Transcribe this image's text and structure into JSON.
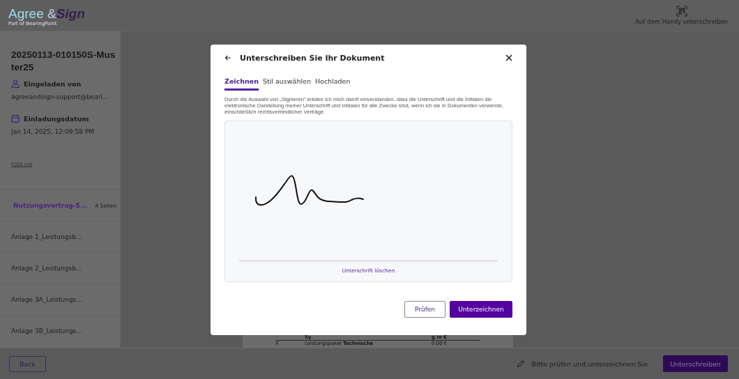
{
  "header": {
    "logo": {
      "word_1": "Agree",
      "ampersand": "&",
      "word_2": "Sign",
      "tagline": "Part of BearingPoint"
    },
    "mobile_sign": "Auf dem Handy unterschreiben"
  },
  "sidebar": {
    "document_title": "20250113-010150S-Muster25",
    "invited_by": {
      "label": "Eingeladen von",
      "value": "agreeandsign-support@beari..."
    },
    "invitation_date": {
      "label": "Einladungsdatum",
      "value": "Jan 14, 2025, 12:09:58 PM"
    },
    "foss_link": "FOSS List",
    "documents": [
      {
        "name": "Nutzungsvertrag-S...",
        "pages": "4 Seiten",
        "selected": true
      },
      {
        "name": "Anlage 1_Leistungsb...",
        "selected": false
      },
      {
        "name": "Anlage 2_Leistungsb...",
        "selected": false
      },
      {
        "name": "Anlage 3A_Leistungs...",
        "selected": false
      },
      {
        "name": "Anlage 3B_Leistungs...",
        "selected": false
      }
    ]
  },
  "document_preview": {
    "header_cells": [
      "Sy",
      "g in €"
    ],
    "row_cells": [
      "X",
      "Leistungspaket **Technische**",
      "0.00 €"
    ]
  },
  "dialog": {
    "title": "Unterschreiben Sie Ihr Dokument",
    "tabs": [
      {
        "label": "Zeichnen",
        "selected": true
      },
      {
        "label": "Stil auswählen",
        "selected": false
      },
      {
        "label": "Hochladen",
        "selected": false
      }
    ],
    "consent_text": "Durch die Auswahl von „Signieren\" erkläre ich mich damit einverstanden, dass die Unterschrift und die Initialen die elektronische Darstellung meiner Unterschrift und Initialen für alle Zwecke sind, wenn ich sie in Dokumenten verwende, einschließlich rechtsverbindlicher Verträge.",
    "clear_link": "Unterschrift löschen",
    "buttons": [
      {
        "label": "Prüfen",
        "kind": "secondary"
      },
      {
        "label": "Unterzeichnen",
        "kind": "primary"
      }
    ]
  },
  "footer": {
    "back_button": "Back",
    "hint": "Bitte prüfen und unterzeichnen Sie",
    "sign_button": "Unterschreiben"
  }
}
